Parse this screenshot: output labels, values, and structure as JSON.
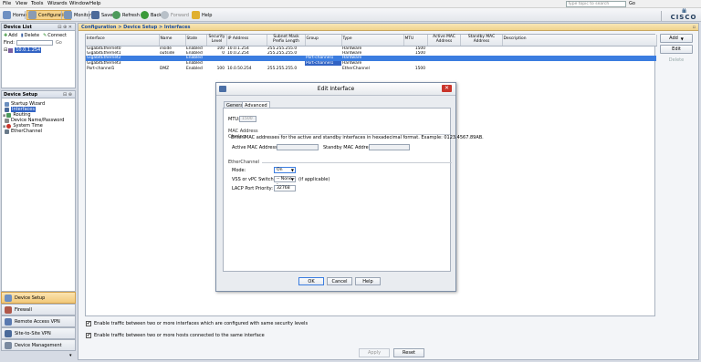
{
  "menubar": {
    "items": [
      "File",
      "View",
      "Tools",
      "Wizards",
      "Window",
      "Help"
    ],
    "search_placeholder": "Type topic to search",
    "go_label": "Go"
  },
  "toolbar": {
    "home": "Home",
    "configuration": "Configuration",
    "monitoring": "Monitoring",
    "save": "Save",
    "refresh": "Refresh",
    "back": "Back",
    "forward": "Forward",
    "help": "Help"
  },
  "brand": {
    "bars": "ılıılı",
    "word": "CISCO"
  },
  "device_list": {
    "title": "Device List",
    "controls": "⊟ ⊕ ✕",
    "add": "Add",
    "delete": "Delete",
    "connect": "Connect",
    "find_label": "Find:",
    "go_label": "Go",
    "device": "10.0.1.254"
  },
  "device_setup": {
    "title": "Device Setup",
    "controls": "⊟ ⊕",
    "tree": [
      "Startup Wizard",
      "Interfaces",
      "Routing",
      "Device Name/Password",
      "System Time",
      "EtherChannel"
    ]
  },
  "nav": {
    "device_setup": "Device Setup",
    "firewall": "Firewall",
    "remote_access_vpn": "Remote Access VPN",
    "site_to_site_vpn": "Site-to-Site VPN",
    "device_management": "Device Management"
  },
  "breadcrumb": "Configuration > Device Setup > Interfaces",
  "table": {
    "headers": [
      "Interface",
      "Name",
      "State",
      "Security Level",
      "IP Address",
      "Subnet Mask Prefix Length",
      "Group",
      "Type",
      "MTU",
      "Active MAC Address",
      "Standby MAC Address",
      "Description"
    ],
    "rows": [
      [
        "GigabitEthernet0",
        "inside",
        "Enabled",
        "100",
        "10.0.1.254",
        "255.255.255.0",
        "",
        "Hardware",
        "1500",
        "",
        "",
        ""
      ],
      [
        "GigabitEthernet1",
        "outside",
        "Enabled",
        "0",
        "10.0.2.254",
        "255.255.255.0",
        "",
        "Hardware",
        "1500",
        "",
        "",
        ""
      ],
      [
        "GigabitEthernet2",
        "",
        "Enabled",
        "",
        "",
        "",
        "Port-channel1",
        "Hardware",
        "",
        "",
        "",
        ""
      ],
      [
        "GigabitEthernet3",
        "",
        "Enabled",
        "",
        "",
        "",
        "Port-channel1",
        "Hardware",
        "",
        "",
        "",
        ""
      ],
      [
        "Port-channel1",
        "DMZ",
        "Enabled",
        "100",
        "10.0.50.254",
        "255.255.255.0",
        "",
        "EtherChannel",
        "1500",
        "",
        "",
        ""
      ]
    ]
  },
  "right_buttons": {
    "add": "Add",
    "edit": "Edit",
    "delete": "Delete"
  },
  "checkbox1": "Enable traffic between two or more interfaces which are configured with same security levels",
  "checkbox2": "Enable traffic between two or more hosts connected to the same interface",
  "apply": "Apply",
  "reset": "Reset",
  "dialog": {
    "title": "Edit Interface",
    "tabs": [
      "General",
      "Advanced"
    ],
    "mtu_label": "MTU:",
    "mtu_value": "1500",
    "mac_group": "MAC Address Cloning",
    "mac_hint": "Enter MAC addresses for the active and standby interfaces in hexadecimal format. Example: 0123.4567.89AB.",
    "active_mac_label": "Active MAC Address:",
    "standby_mac_label": "Standby MAC Address:",
    "ec_group": "EtherChannel",
    "mode_label": "Mode:",
    "mode_value": "On",
    "vss_label": "VSS or vPC Switch ID:",
    "vss_value": "-- None --",
    "vss_suffix": "(if applicable)",
    "lacp_label": "LACP Port Priority:",
    "lacp_value": "32768",
    "ok": "OK",
    "cancel": "Cancel",
    "help": "Help"
  },
  "colors": {
    "accent": "#3b7de0",
    "tab_orange": "#f2c97a",
    "close_red": "#c9342a"
  }
}
